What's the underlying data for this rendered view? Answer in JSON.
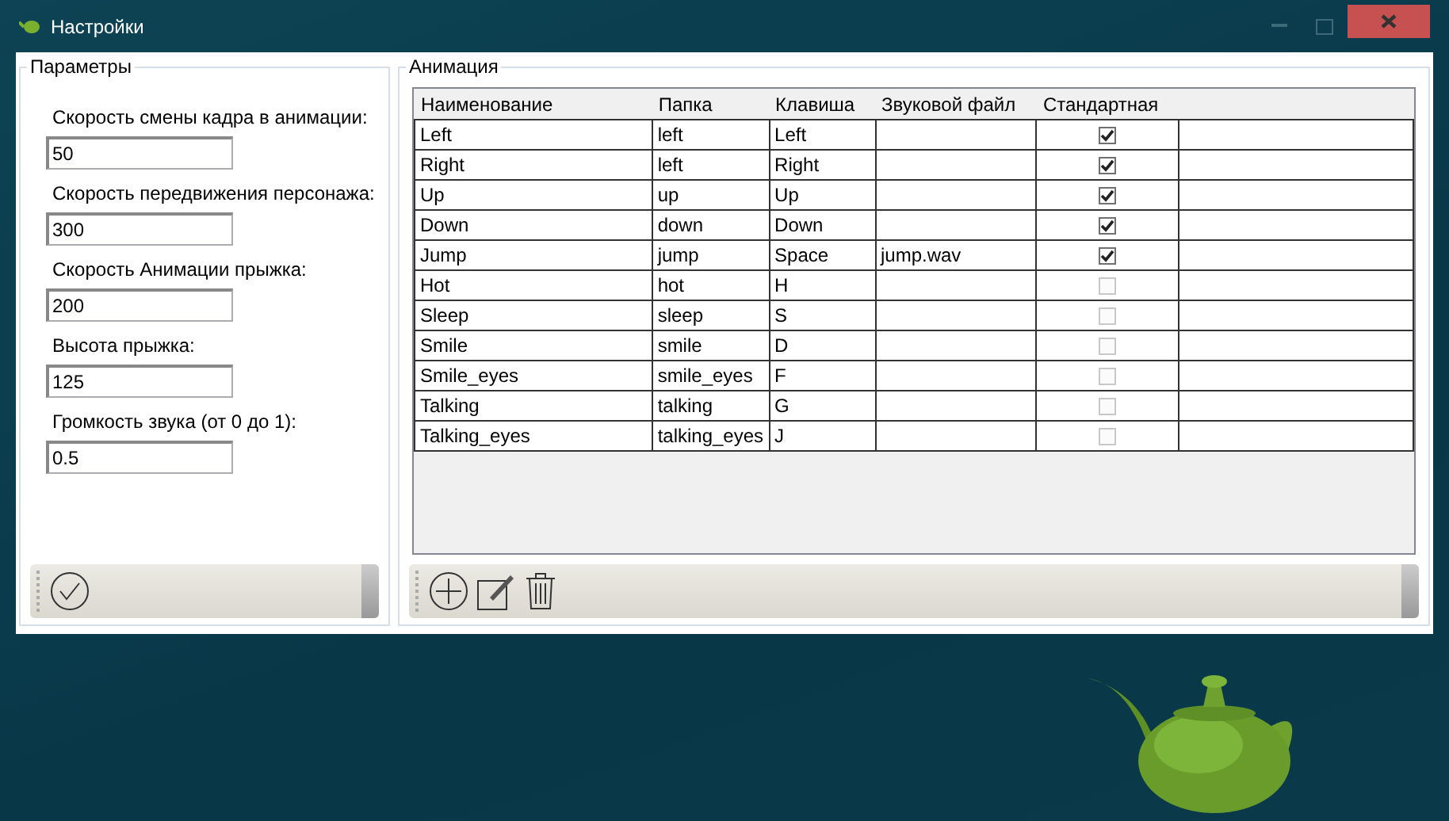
{
  "window": {
    "title": "Настройки"
  },
  "parameters": {
    "title": "Параметры",
    "fields": [
      {
        "label": "Скорость смены кадра в анимации:",
        "value": "50"
      },
      {
        "label": "Скорость передвижения персонажа:",
        "value": "300"
      },
      {
        "label": "Скорость Анимации прыжка:",
        "value": "200"
      },
      {
        "label": "Высота прыжка:",
        "value": "125"
      },
      {
        "label": "Громкость звука (от 0 до 1):",
        "value": "0.5"
      }
    ]
  },
  "animation": {
    "title": "Анимация",
    "columns": [
      "Наименование",
      "Папка",
      "Клавиша",
      "Звуковой файл",
      "Стандартная"
    ],
    "rows": [
      {
        "name": "Left",
        "folder": "left",
        "key": "Left",
        "standard": true
      },
      {
        "name": "Right",
        "folder": "left",
        "key": "Right",
        "standard": true
      },
      {
        "name": "Up",
        "folder": "up",
        "key": "Up",
        "standard": true
      },
      {
        "name": "Down",
        "folder": "down",
        "key": "Down",
        "standard": true
      },
      {
        "name": "Jump",
        "folder": "jump",
        "key": "Space",
        "sound": "jump.wav",
        "standard": true
      },
      {
        "name": "Hot",
        "folder": "hot",
        "key": "H",
        "standard": false
      },
      {
        "name": "Sleep",
        "folder": "sleep",
        "key": "S",
        "standard": false
      },
      {
        "name": "Smile",
        "folder": "smile",
        "key": "D",
        "standard": false
      },
      {
        "name": "Smile_eyes",
        "folder": "smile_eyes",
        "key": "F",
        "standard": false
      },
      {
        "name": "Talking",
        "folder": "talking",
        "key": "G",
        "standard": false
      },
      {
        "name": "Talking_eyes",
        "folder": "talking_eyes",
        "key": "J",
        "standard": false
      }
    ]
  }
}
